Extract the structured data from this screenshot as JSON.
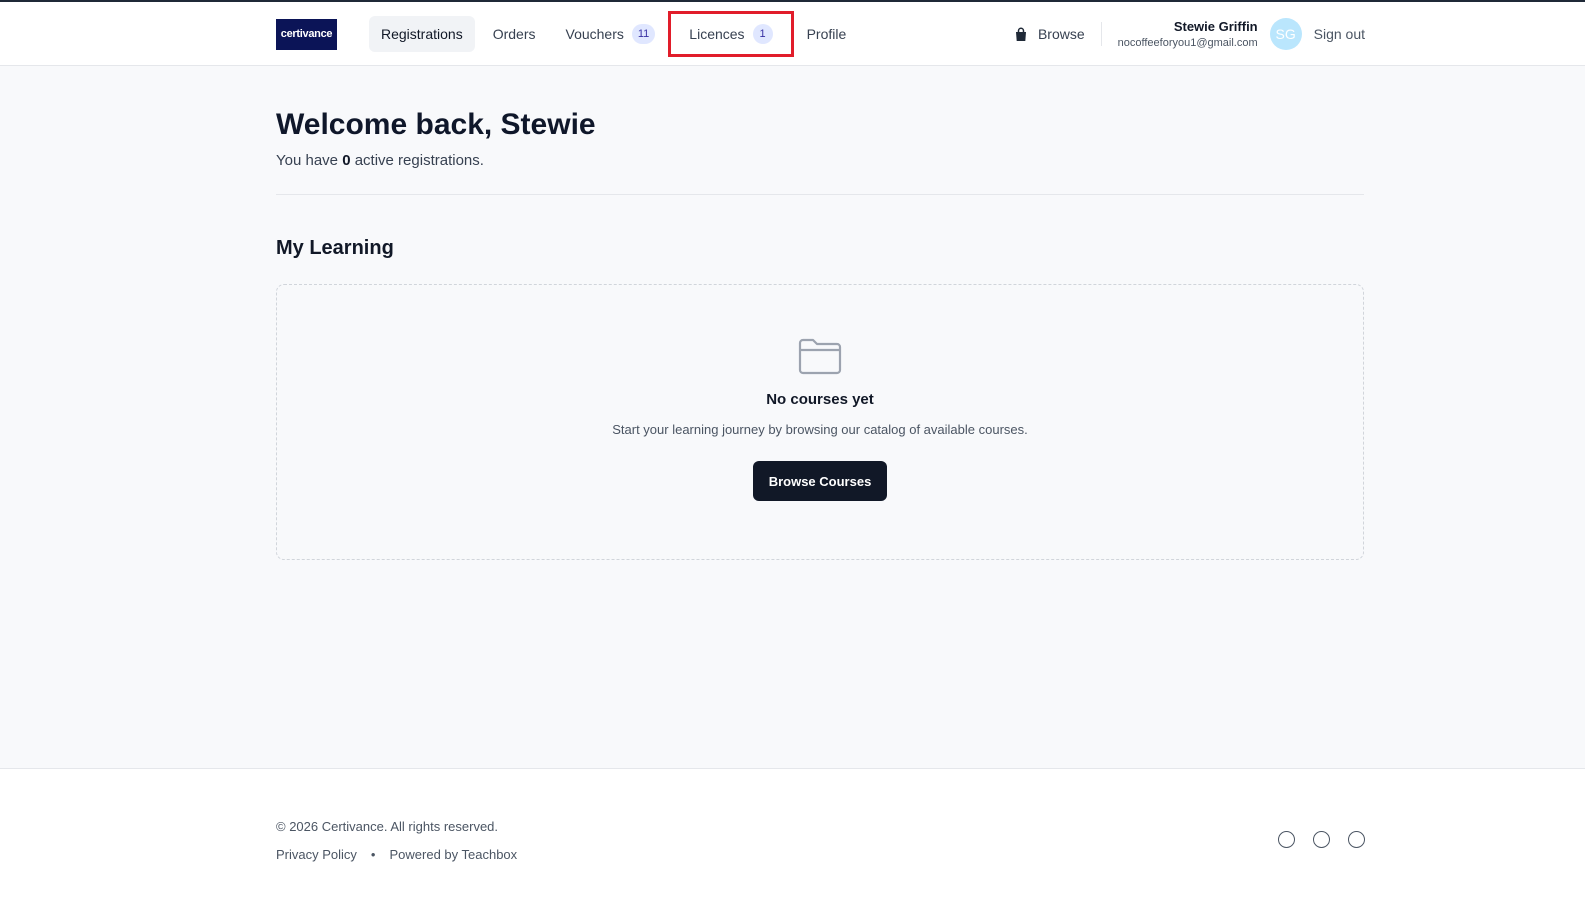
{
  "brand": {
    "logo_text": "certivance",
    "logo_color": "#0b1457"
  },
  "nav": {
    "items": [
      {
        "label": "Registrations",
        "badge": null
      },
      {
        "label": "Orders",
        "badge": null
      },
      {
        "label": "Vouchers",
        "badge": "11"
      },
      {
        "label": "Licences",
        "badge": "1"
      },
      {
        "label": "Profile",
        "badge": null
      }
    ],
    "browse_label": "Browse"
  },
  "user": {
    "name": "Stewie Griffin",
    "email": "nocoffeeforyou1@gmail.com",
    "initials": "SG",
    "signout_label": "Sign out"
  },
  "main": {
    "welcome": "Welcome back, Stewie",
    "subtitle_prefix": "You have",
    "active_count": "0",
    "subtitle_suffix": "active registrations.",
    "section_title": "My Learning",
    "empty": {
      "title": "No courses yet",
      "description": "Start your learning journey by browsing our catalog of available courses.",
      "button_label": "Browse Courses"
    }
  },
  "footer": {
    "copyright": "© 2026 Certivance. All rights reserved.",
    "privacy": "Privacy Policy",
    "separator": "•",
    "powered": "Powered by Teachbox"
  },
  "colors": {
    "highlight": "#e11d2a",
    "primary_button": "#111827",
    "badge_bg": "#e0e7ff"
  }
}
